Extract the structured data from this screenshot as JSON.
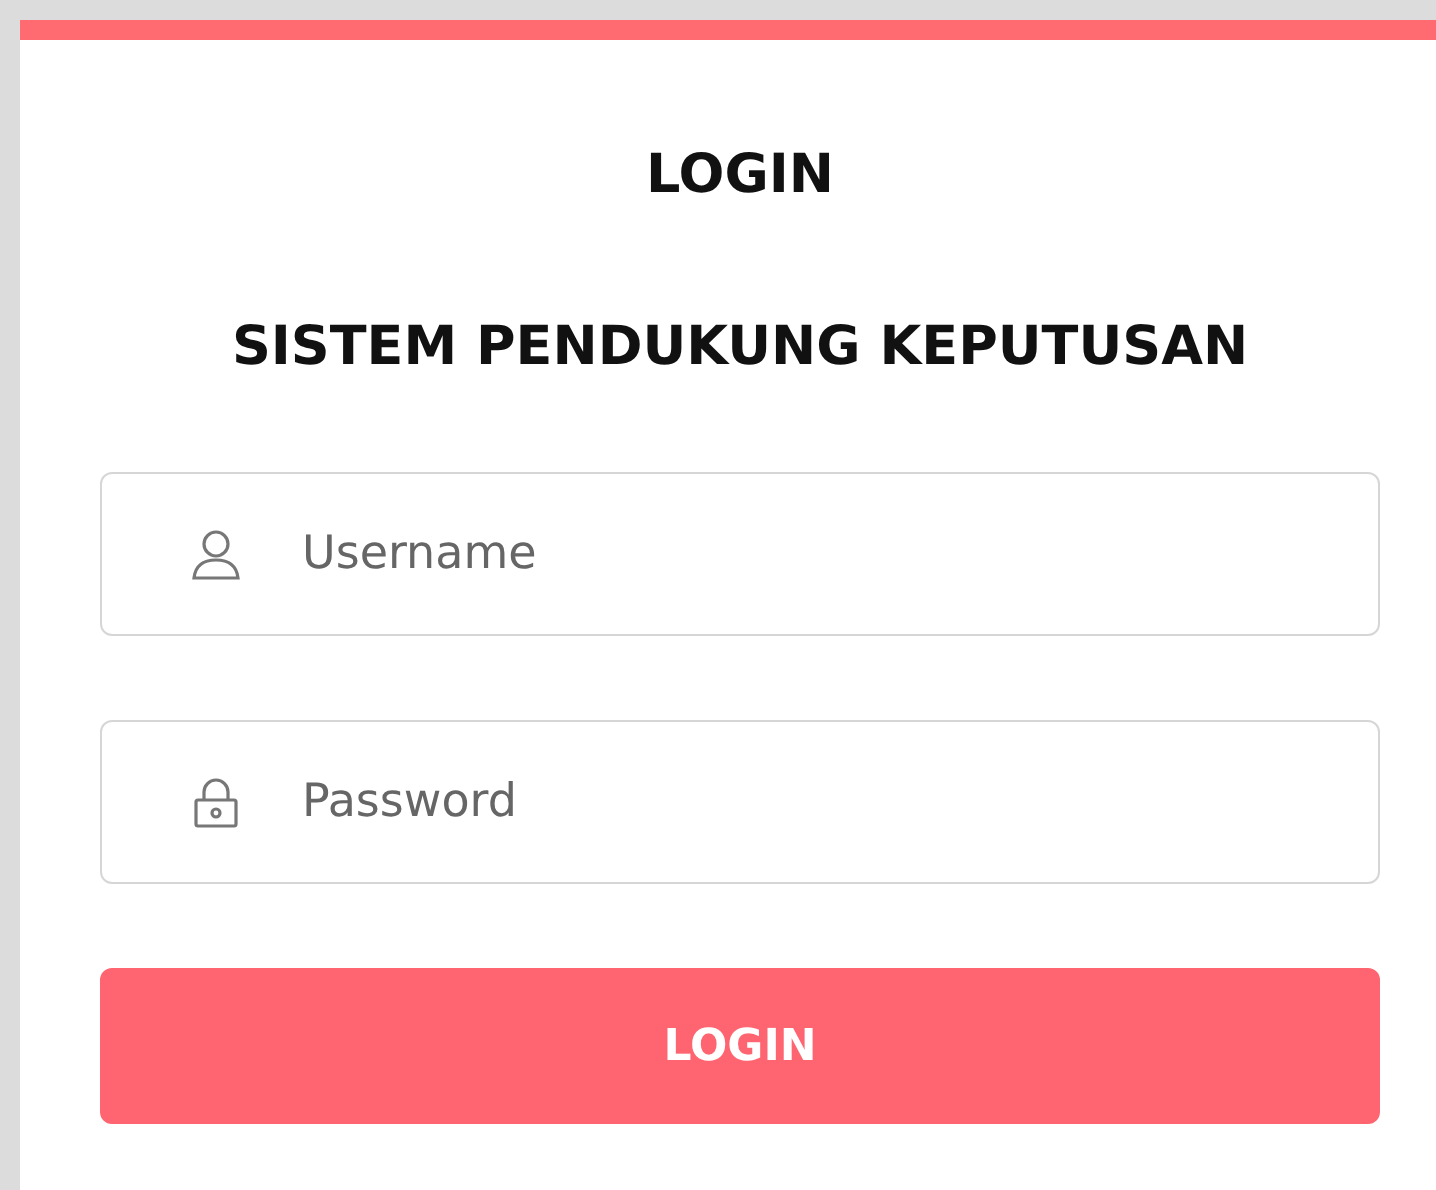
{
  "title": "LOGIN",
  "subtitle": "SISTEM PENDUKUNG KEPUTUSAN",
  "fields": [
    {
      "kind": "user",
      "placeholder": "Username"
    },
    {
      "kind": "lock",
      "placeholder": "Password"
    }
  ],
  "button": "LOGIN"
}
